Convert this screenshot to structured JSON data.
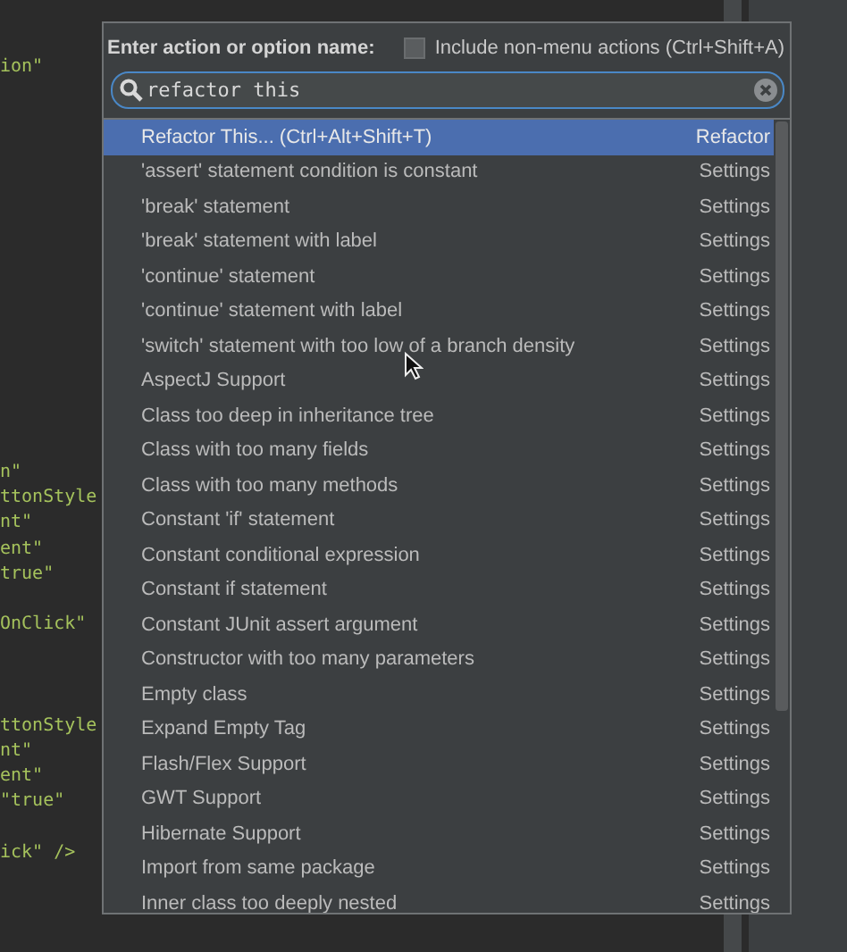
{
  "editor": {
    "lines": [
      {
        "text": "ion\""
      },
      {
        "text": "n\""
      },
      {
        "text": "ttonStyle"
      },
      {
        "text": "nt\""
      },
      {
        "text": "ent\""
      },
      {
        "text": "true\""
      },
      {
        "text": "OnClick\""
      },
      {
        "text": "ttonStyle"
      },
      {
        "text": "nt\""
      },
      {
        "text": "ent\""
      },
      {
        "text": "\"true\""
      },
      {
        "text": "ick\" />"
      }
    ]
  },
  "popup": {
    "prompt": "Enter action or option name:",
    "include_option": {
      "label": "Include non-menu actions (Ctrl+Shift+A)",
      "checked": false
    },
    "search": {
      "value": "refactor this"
    },
    "results": [
      {
        "name": "Refactor This... (Ctrl+Alt+Shift+T)",
        "group": "Refactor",
        "selected": true
      },
      {
        "name": "'assert' statement condition is constant",
        "group": "Settings",
        "selected": false
      },
      {
        "name": "'break' statement",
        "group": "Settings",
        "selected": false
      },
      {
        "name": "'break' statement with label",
        "group": "Settings",
        "selected": false
      },
      {
        "name": "'continue' statement",
        "group": "Settings",
        "selected": false
      },
      {
        "name": "'continue' statement with label",
        "group": "Settings",
        "selected": false
      },
      {
        "name": "'switch' statement with too low of a branch density",
        "group": "Settings",
        "selected": false
      },
      {
        "name": "AspectJ Support",
        "group": "Settings",
        "selected": false
      },
      {
        "name": "Class too deep in inheritance tree",
        "group": "Settings",
        "selected": false
      },
      {
        "name": "Class with too many fields",
        "group": "Settings",
        "selected": false
      },
      {
        "name": "Class with too many methods",
        "group": "Settings",
        "selected": false
      },
      {
        "name": "Constant 'if' statement",
        "group": "Settings",
        "selected": false
      },
      {
        "name": "Constant conditional expression",
        "group": "Settings",
        "selected": false
      },
      {
        "name": "Constant if statement",
        "group": "Settings",
        "selected": false
      },
      {
        "name": "Constant JUnit assert argument",
        "group": "Settings",
        "selected": false
      },
      {
        "name": "Constructor with too many parameters",
        "group": "Settings",
        "selected": false
      },
      {
        "name": "Empty class",
        "group": "Settings",
        "selected": false
      },
      {
        "name": "Expand Empty Tag",
        "group": "Settings",
        "selected": false
      },
      {
        "name": "Flash/Flex Support",
        "group": "Settings",
        "selected": false
      },
      {
        "name": "GWT Support",
        "group": "Settings",
        "selected": false
      },
      {
        "name": "Hibernate Support",
        "group": "Settings",
        "selected": false
      },
      {
        "name": "Import from same package",
        "group": "Settings",
        "selected": false
      },
      {
        "name": "Inner class too deeply nested",
        "group": "Settings",
        "selected": false
      }
    ]
  }
}
